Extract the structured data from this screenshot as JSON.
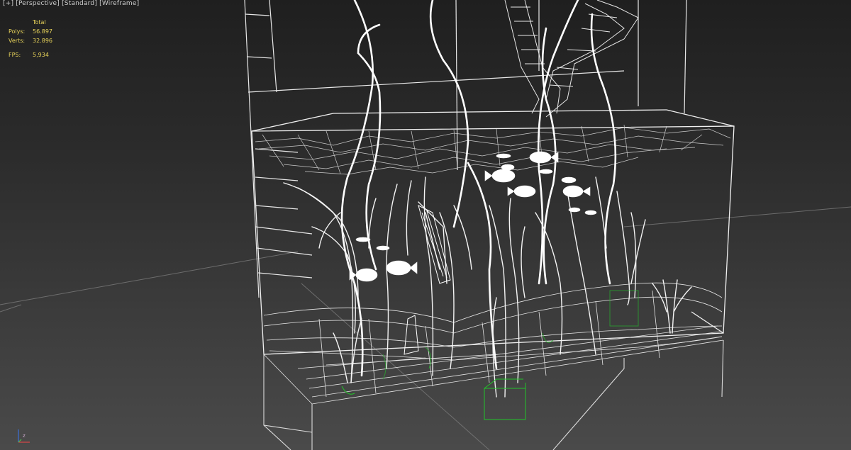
{
  "viewport": {
    "label_parts": [
      "+",
      "Perspective",
      "Standard",
      "Wireframe"
    ],
    "shading_mode": "Wireframe",
    "background": "#2c2c2c",
    "wire_color": "#ffffff",
    "helper_color": "#22c42a",
    "grid_color": "#7a7a7a"
  },
  "stats": {
    "header": "Total",
    "polys_label": "Polys:",
    "polys_value": "56.897",
    "verts_label": "Verts:",
    "verts_value": "32.896",
    "fps_label": "FPS:",
    "fps_value": "5,934",
    "text_color": "#e8d35a"
  },
  "axis": {
    "label": "z",
    "icon": "axis-tripod-icon"
  }
}
